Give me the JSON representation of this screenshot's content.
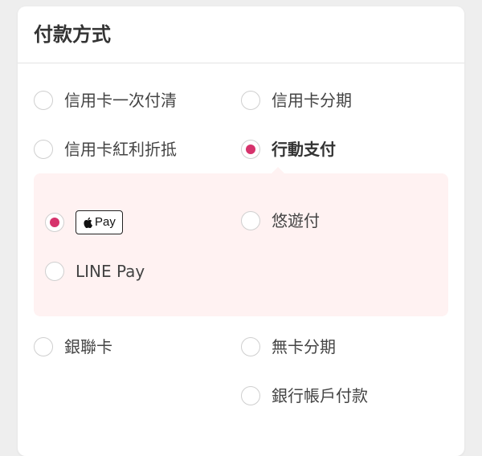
{
  "card": {
    "title": "付款方式"
  },
  "options": {
    "credit_full": "信用卡一次付清",
    "credit_installment": "信用卡分期",
    "credit_rewards": "信用卡紅利折抵",
    "mobile_payment": "行動支付",
    "unionpay": "銀聯卡",
    "cardless_installment": "無卡分期",
    "bank_account": "銀行帳戶付款"
  },
  "mobile_sub": {
    "apple_pay": "Pay",
    "easy_wallet": "悠遊付",
    "line_pay": "LINE Pay"
  },
  "selected": {
    "method": "行動支付",
    "mobile": "Apple Pay"
  },
  "colors": {
    "accent": "#d6336c",
    "subpanel_bg": "#fff2f2",
    "radio_border": "#cfcfcf"
  },
  "icons": {
    "apple": "apple-logo-icon"
  }
}
